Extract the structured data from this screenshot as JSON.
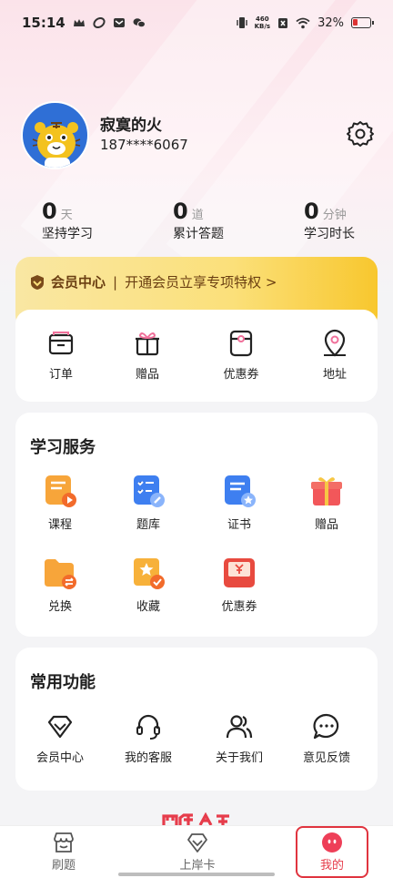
{
  "status": {
    "time": "15:14",
    "speed_top": "460",
    "speed_unit": "KB/s",
    "battery": "32%"
  },
  "profile": {
    "name": "寂寞的火",
    "phone": "187****6067"
  },
  "stats": [
    {
      "num": "0",
      "unit": "天",
      "label": "坚持学习"
    },
    {
      "num": "0",
      "unit": "道",
      "label": "累计答题"
    },
    {
      "num": "0",
      "unit": "分钟",
      "label": "学习时长"
    }
  ],
  "member": {
    "title": "会员中心",
    "separator": "|",
    "promo": "开通会员立享专项特权 >"
  },
  "quick": [
    {
      "label": "订单",
      "icon": "order-box-icon"
    },
    {
      "label": "赠品",
      "icon": "gift-icon"
    },
    {
      "label": "优惠券",
      "icon": "coupon-icon"
    },
    {
      "label": "地址",
      "icon": "location-pin-icon"
    }
  ],
  "services": {
    "title": "学习服务",
    "items": [
      {
        "label": "课程",
        "icon": "course-icon"
      },
      {
        "label": "题库",
        "icon": "question-bank-icon"
      },
      {
        "label": "证书",
        "icon": "certificate-icon"
      },
      {
        "label": "赠品",
        "icon": "gift-box-icon"
      },
      {
        "label": "兑换",
        "icon": "exchange-folder-icon"
      },
      {
        "label": "收藏",
        "icon": "favorites-icon"
      },
      {
        "label": "优惠券",
        "icon": "red-coupon-icon"
      }
    ]
  },
  "common": {
    "title": "常用功能",
    "items": [
      {
        "label": "会员中心",
        "icon": "diamond-icon"
      },
      {
        "label": "我的客服",
        "icon": "headset-icon"
      },
      {
        "label": "关于我们",
        "icon": "users-icon"
      },
      {
        "label": "意见反馈",
        "icon": "chat-bubble-icon"
      }
    ]
  },
  "nav": {
    "items": [
      {
        "label": "刷题"
      },
      {
        "label": "上岸卡"
      },
      {
        "label": "我的"
      }
    ]
  },
  "colors": {
    "accent": "#e63c4b",
    "member_text": "#6b3f12"
  }
}
